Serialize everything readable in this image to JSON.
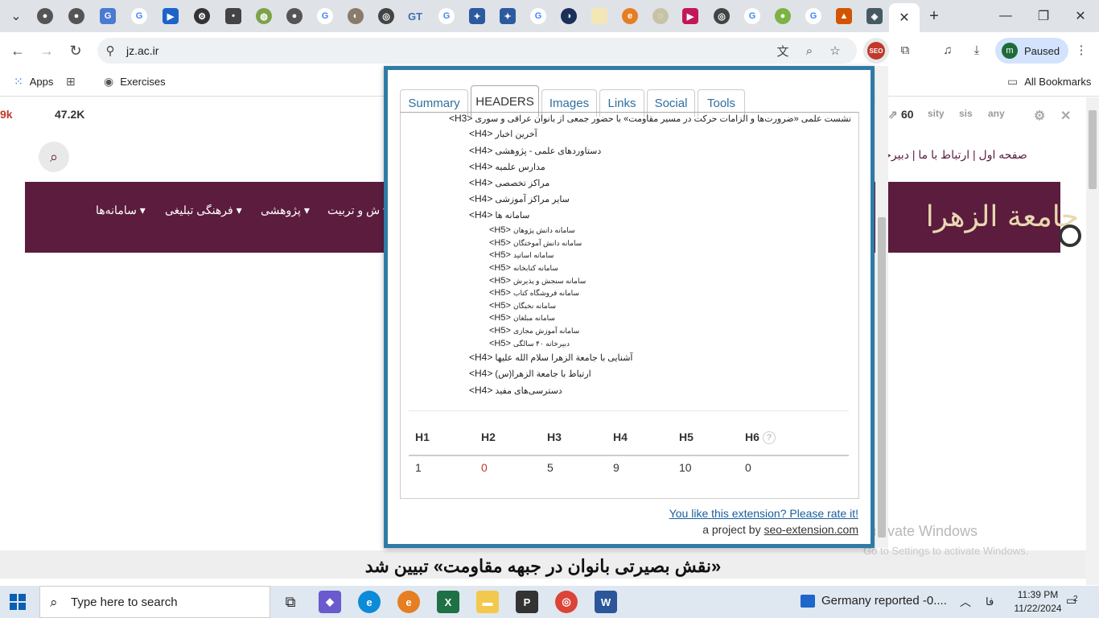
{
  "browser": {
    "active_tab_close": "✕",
    "new_tab": "+",
    "url": "jz.ac.ir",
    "profile": {
      "initial": "m",
      "status": "Paused"
    },
    "bookmarks": [
      {
        "label": "Apps"
      },
      {
        "label": "Exercises"
      },
      {
        "label": "All Bookmarks"
      }
    ],
    "seo_badge": "SEO"
  },
  "page": {
    "strip_left": [
      "9k",
      "47.2K"
    ],
    "strip_right_count": "60",
    "strip_right_labels": [
      "sity",
      "sis",
      "any"
    ],
    "top_links": "صفحه اول  |  ارتباط با ما  |  دبیرخا",
    "menu": [
      "سامانه‌ها",
      "فرهنگی تبلیغی",
      "پژوهشی",
      "ش و تربیت"
    ],
    "logo": "جامعة الزهرا",
    "caption": "«نقش بصیرتی بانوان در جبهه مقاومت» تبیین شد",
    "activate_title": "Activate Windows",
    "activate_sub": "Go to Settings to activate Windows."
  },
  "popup": {
    "tabs": [
      "Summary",
      "HEADERS",
      "Images",
      "Links",
      "Social",
      "Tools"
    ],
    "active_tab": "HEADERS",
    "headers": [
      {
        "tag": "<H3>",
        "text": "نشست علمی «ضرورت‌ها و الزامات حرکت در مسیر مقاومت» با حضور جمعی از بانوان عراقی و سوری"
      },
      {
        "tag": "<H4>",
        "text": "آخرین اخبار"
      },
      {
        "tag": "<H4>",
        "text": "دستاوردهای علمی - پژوهشی"
      },
      {
        "tag": "<H4>",
        "text": "مدارس علمیه"
      },
      {
        "tag": "<H4>",
        "text": "مراکز تخصصی"
      },
      {
        "tag": "<H4>",
        "text": "سایر مراکز آموزشی"
      },
      {
        "tag": "<H4>",
        "text": "سامانه ها"
      },
      {
        "tag": "<H5>",
        "text": "سامانه دانش پژوهان"
      },
      {
        "tag": "<H5>",
        "text": "سامانه دانش آموختگان"
      },
      {
        "tag": "<H5>",
        "text": "سامانه اساتید"
      },
      {
        "tag": "<H5>",
        "text": "سامانه کتابخانه"
      },
      {
        "tag": "<H5>",
        "text": "سامانه سنجش و پذیرش"
      },
      {
        "tag": "<H5>",
        "text": "سامانه فروشگاه کتاب"
      },
      {
        "tag": "<H5>",
        "text": "سامانه نخبگان"
      },
      {
        "tag": "<H5>",
        "text": "سامانه مبلغان"
      },
      {
        "tag": "<H5>",
        "text": "سامانه آموزش مجازی"
      },
      {
        "tag": "<H5>",
        "text": "دبیرخانه ۴۰ سالگی"
      },
      {
        "tag": "<H4>",
        "text": "آشنایی با جامعة الزهرا سلام الله علیها"
      },
      {
        "tag": "<H4>",
        "text": "ارتباط با جامعة الزهرا(س)"
      },
      {
        "tag": "<H4>",
        "text": "دسترسی‌های مفید"
      }
    ],
    "counts": [
      {
        "label": "H1",
        "value": "1"
      },
      {
        "label": "H2",
        "value": "0"
      },
      {
        "label": "H3",
        "value": "5"
      },
      {
        "label": "H4",
        "value": "9"
      },
      {
        "label": "H5",
        "value": "10"
      },
      {
        "label": "H6",
        "value": "0"
      }
    ],
    "help": "?",
    "rate_text": "You like this extension? Please rate it!",
    "project_prefix": "a project by",
    "project_link": "seo-extension.com"
  },
  "taskbar": {
    "search_placeholder": "Type here to search",
    "news": "Germany reported -0....",
    "lang": "فا",
    "time": "11:39 PM",
    "date": "11/22/2024",
    "notifications": "2"
  },
  "colors": {
    "popup_border": "#2f7ba6",
    "banner": "#5b1c3e",
    "link": "#1a5f9e",
    "red_count": "#c0392b"
  }
}
